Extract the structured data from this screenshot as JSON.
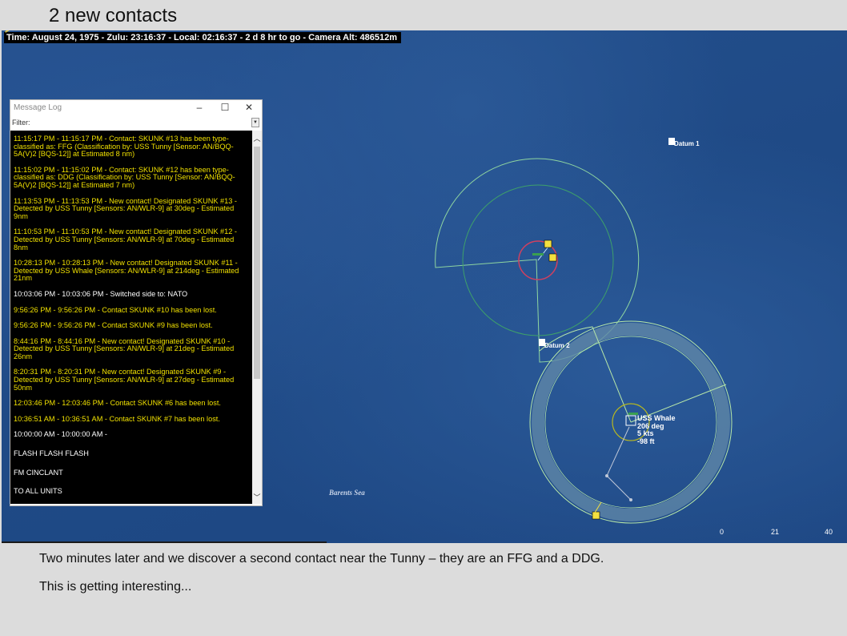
{
  "page_title": "2 new contacts",
  "status_bar": {
    "text": "Time: August 24, 1975 - Zulu: 23:16:37 - Local: 02:16:37 - 2 d 8 hr to go -  Camera Alt: 486512m"
  },
  "message_log": {
    "title": "Message Log",
    "filter_label": "Filter:",
    "messages": [
      {
        "text": "11:15:17 PM - 11:15:17 PM - Contact: SKUNK #13 has been type-classified as: FFG (Classification by: USS Tunny [Sensor: AN/BQQ-5A(V)2 [BQS-12]] at Estimated 8 nm)",
        "color": "#f0e000"
      },
      {
        "text": "11:15:02 PM - 11:15:02 PM - Contact: SKUNK #12 has been type-classified as: DDG (Classification by: USS Tunny [Sensor: AN/BQQ-5A(V)2 [BQS-12]] at Estimated 7 nm)",
        "color": "#f0e000"
      },
      {
        "text": "11:13:53 PM - 11:13:53 PM - New contact! Designated SKUNK #13 - Detected by USS Tunny [Sensors: AN/WLR-9] at 30deg - Estimated 9nm",
        "color": "#f0e000"
      },
      {
        "text": "11:10:53 PM - 11:10:53 PM - New contact! Designated SKUNK #12 - Detected by USS Tunny [Sensors: AN/WLR-9] at 70deg - Estimated 8nm",
        "color": "#f0e000"
      },
      {
        "text": "10:28:13 PM - 10:28:13 PM - New contact! Designated SKUNK #11 - Detected by USS Whale [Sensors: AN/WLR-9] at 214deg - Estimated 21nm",
        "color": "#f0e000"
      },
      {
        "text": "10:03:06 PM - 10:03:06 PM - Switched side to: NATO",
        "color": "#ffffff"
      },
      {
        "text": "9:56:26 PM - 9:56:26 PM - Contact SKUNK #10 has been lost.",
        "color": "#f0e000"
      },
      {
        "text": "9:56:26 PM - 9:56:26 PM - Contact SKUNK #9 has been lost.",
        "color": "#f0e000"
      },
      {
        "text": "8:44:16 PM - 8:44:16 PM - New contact! Designated SKUNK #10 - Detected by USS Tunny [Sensors: AN/WLR-9] at 21deg - Estimated 26nm",
        "color": "#f0e000"
      },
      {
        "text": "8:20:31 PM - 8:20:31 PM - New contact! Designated SKUNK #9 - Detected by USS Tunny [Sensors: AN/WLR-9] at 27deg - Estimated 50nm",
        "color": "#f0e000"
      },
      {
        "text": "12:03:46 PM - 12:03:46 PM - Contact SKUNK #6 has been lost.",
        "color": "#f0e000"
      },
      {
        "text": "10:36:51 AM - 10:36:51 AM - Contact SKUNK #7 has been lost.",
        "color": "#f0e000"
      },
      {
        "text": "10:00:00 AM - 10:00:00 AM -",
        "color": "#ffffff"
      },
      {
        "text": "FLASH FLASH FLASH",
        "color": "#ffffff"
      },
      {
        "text": "FM CINCLANT",
        "color": "#ffffff"
      },
      {
        "text": "TO ALL UNITS",
        "color": "#ffffff"
      }
    ]
  },
  "map": {
    "datum1": "Datum 1",
    "datum2": "Datum 2",
    "sea_label": "Barents Sea",
    "whale": {
      "name": "USS Whale",
      "heading": "206 deg",
      "speed": "5 kts",
      "depth": "-98 ft"
    },
    "scale": [
      "0",
      "21",
      "40"
    ]
  },
  "captions": [
    "Two minutes later and we discover a second contact near the Tunny – they are an FFG and a DDG.",
    "This is getting interesting..."
  ],
  "colors": {
    "sea": "#1f4a86",
    "message_yellow": "#f0e000",
    "arc_green": "#9fe0a0"
  }
}
